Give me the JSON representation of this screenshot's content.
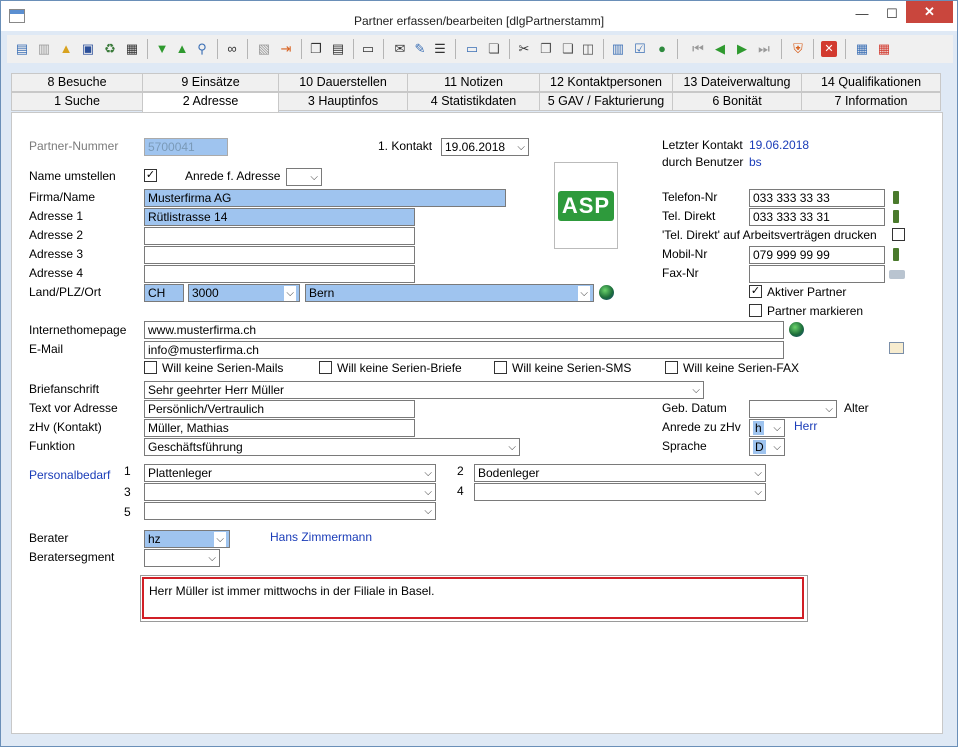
{
  "window": {
    "title": "Partner erfassen/bearbeiten [dlgPartnerstamm]"
  },
  "tabs_row1": [
    "8 Besuche",
    "9 Einsätze",
    "10 Dauerstellen",
    "11 Notizen",
    "12 Kontaktpersonen",
    "13 Dateiverwaltung",
    "14 Qualifikationen"
  ],
  "tabs_row2": [
    "1 Suche",
    "2 Adresse",
    "3 Hauptinfos",
    "4 Statistikdaten",
    "5 GAV / Fakturierung",
    "6 Bonität",
    "7 Information"
  ],
  "form": {
    "partner_nummer_label": "Partner-Nummer",
    "partner_nummer": "5700041",
    "kontakt_label": "1. Kontakt",
    "kontakt_value": "19.06.2018",
    "letzter_kontakt_label": "Letzter Kontakt",
    "letzter_kontakt_value": "19.06.2018",
    "benutzer_label": "durch Benutzer",
    "benutzer_value": "bs",
    "name_umstellen_label": "Name umstellen",
    "anrede_adresse_label": "Anrede f. Adresse",
    "firma_label": "Firma/Name",
    "firma_value": "Musterfirma AG",
    "adresse1_label": "Adresse 1",
    "adresse1_value": "Rütlistrasse 14",
    "adresse2_label": "Adresse 2",
    "adresse3_label": "Adresse 3",
    "adresse4_label": "Adresse 4",
    "land_label": "Land/PLZ/Ort",
    "land_value": "CH",
    "plz_value": "3000",
    "ort_value": "Bern",
    "logo_text": "ASP",
    "telefon_label": "Telefon-Nr",
    "telefon_value": "033 333 33 33",
    "tel_direkt_label": "Tel. Direkt",
    "tel_direkt_value": "033 333 33 31",
    "tel_direkt_druck_label": "'Tel. Direkt' auf Arbeitsverträgen drucken",
    "mobil_label": "Mobil-Nr",
    "mobil_value": "079 999 99 99",
    "fax_label": "Fax-Nr",
    "aktiver_partner_label": "Aktiver Partner",
    "partner_markieren_label": "Partner markieren",
    "homepage_label": "Internethomepage",
    "homepage_value": "www.musterfirma.ch",
    "email_label": "E-Mail",
    "email_value": "info@musterfirma.ch",
    "serien_mails_label": "Will keine Serien-Mails",
    "serien_briefe_label": "Will keine Serien-Briefe",
    "serien_sms_label": "Will keine Serien-SMS",
    "serien_fax_label": "Will keine Serien-FAX",
    "briefanschrift_label": "Briefanschrift",
    "briefanschrift_value": "Sehr geehrter Herr Müller",
    "text_vor_adresse_label": "Text vor Adresse",
    "text_vor_adresse_value": "Persönlich/Vertraulich",
    "zhv_label": "zHv  (Kontakt)",
    "zhv_value": "Müller, Mathias",
    "funktion_label": "Funktion",
    "funktion_value": "Geschäftsführung",
    "geb_datum_label": "Geb. Datum",
    "alter_label": "Alter",
    "anrede_zhv_label": "Anrede zu zHv",
    "anrede_zhv_value": "h",
    "anrede_zhv_text": "Herr",
    "sprache_label": "Sprache",
    "sprache_value": "D",
    "personalbedarf_label": "Personalbedarf",
    "pb_num1": "1",
    "pb_num2": "2",
    "pb_num3": "3",
    "pb_num4": "4",
    "pb_num5": "5",
    "pb1_value": "Plattenleger",
    "pb2_value": "Bodenleger",
    "berater_label": "Berater",
    "berater_value": "hz",
    "berater_name": "Hans Zimmermann",
    "beratersegment_label": "Beratersegment",
    "notiz": "Herr Müller ist immer mittwochs in der Filiale in Basel."
  },
  "checks": {
    "name_umstellen": "✓",
    "aktiver_partner": "✓"
  },
  "colors": {
    "accent_blue": "#1a3cb8",
    "selection": "#9fc4ef",
    "note_border": "#d11f26",
    "close_red": "#c9463d"
  }
}
